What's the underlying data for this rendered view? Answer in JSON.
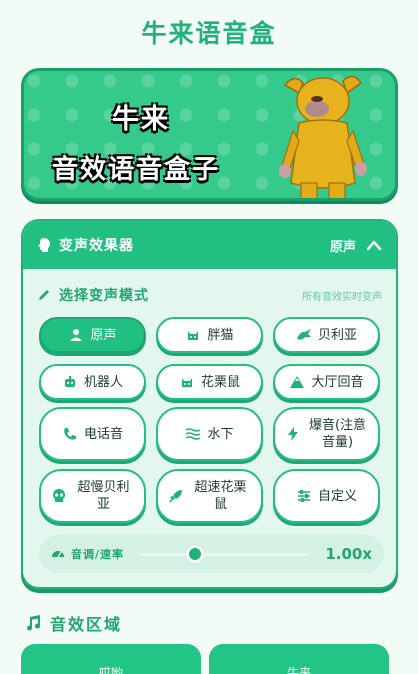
{
  "app": {
    "title": "牛来语音盒"
  },
  "banner": {
    "line1": "牛来",
    "line2": "音效语音盒子"
  },
  "voice_changer": {
    "title": "变声效果器",
    "current_mode": "原声",
    "mode_label": "选择变声模式",
    "hint": "所有音效实时变声",
    "modes": [
      {
        "label": "原声",
        "icon": "person-icon",
        "active": true
      },
      {
        "label": "胖猫",
        "icon": "cat-icon",
        "active": false
      },
      {
        "label": "贝利亚",
        "icon": "dragon-icon",
        "active": false
      },
      {
        "label": "机器人",
        "icon": "robot-icon",
        "active": false
      },
      {
        "label": "花栗鼠",
        "icon": "cat-icon",
        "active": false
      },
      {
        "label": "大厅回音",
        "icon": "mountain-icon",
        "active": false
      },
      {
        "label": "电话音",
        "icon": "phone-icon",
        "active": false
      },
      {
        "label": "水下",
        "icon": "water-icon",
        "active": false
      },
      {
        "label": "爆音(注意音量)",
        "icon": "bolt-icon",
        "active": false
      },
      {
        "label": "超慢贝利亚",
        "icon": "skull-icon",
        "active": false
      },
      {
        "label": "超速花栗鼠",
        "icon": "rocket-icon",
        "active": false
      },
      {
        "label": "自定义",
        "icon": "sliders-icon",
        "active": false
      }
    ],
    "speed": {
      "label": "音调/速率",
      "value": "1.00x",
      "level": 0.33
    }
  },
  "effects": {
    "title": "音效区域",
    "cards": [
      "哎哟",
      "牛来"
    ]
  },
  "colors": {
    "accent": "#22bf82",
    "accent_dark": "#1a9a68",
    "banner": "#35c98b"
  }
}
